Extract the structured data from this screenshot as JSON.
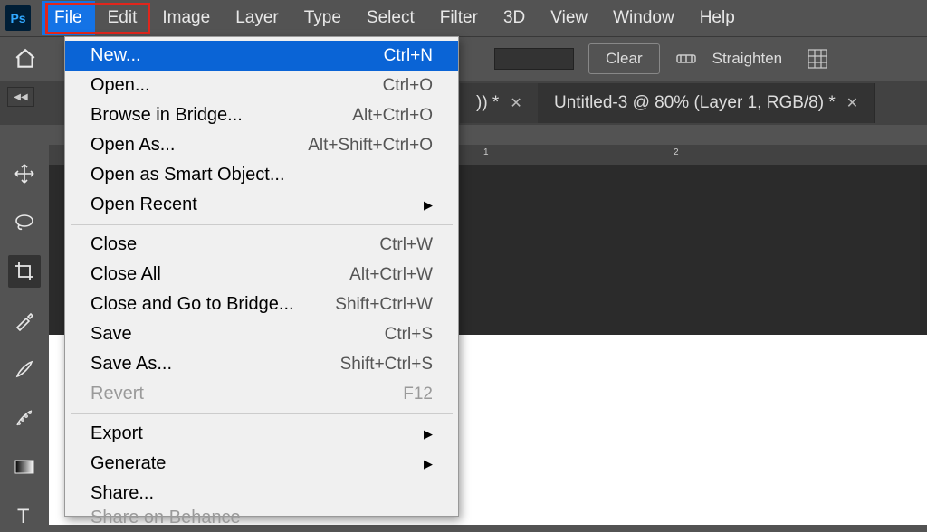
{
  "app": {
    "icon_text": "Ps"
  },
  "menubar": [
    "File",
    "Edit",
    "Image",
    "Layer",
    "Type",
    "Select",
    "Filter",
    "3D",
    "View",
    "Window",
    "Help"
  ],
  "options": {
    "clear_label": "Clear",
    "straighten_label": "Straighten"
  },
  "tabs": {
    "partial_label": ")) *",
    "third_label": "Untitled-3 @ 80% (Layer 1, RGB/8) *"
  },
  "ruler": {
    "t1": "1",
    "t2": "2"
  },
  "dropdown": [
    {
      "label": "New...",
      "shortcut": "Ctrl+N",
      "highlighted": true
    },
    {
      "label": "Open...",
      "shortcut": "Ctrl+O"
    },
    {
      "label": "Browse in Bridge...",
      "shortcut": "Alt+Ctrl+O"
    },
    {
      "label": "Open As...",
      "shortcut": "Alt+Shift+Ctrl+O"
    },
    {
      "label": "Open as Smart Object..."
    },
    {
      "label": "Open Recent",
      "submenu": true
    },
    {
      "sep": true
    },
    {
      "label": "Close",
      "shortcut": "Ctrl+W"
    },
    {
      "label": "Close All",
      "shortcut": "Alt+Ctrl+W"
    },
    {
      "label": "Close and Go to Bridge...",
      "shortcut": "Shift+Ctrl+W"
    },
    {
      "label": "Save",
      "shortcut": "Ctrl+S"
    },
    {
      "label": "Save As...",
      "shortcut": "Shift+Ctrl+S"
    },
    {
      "label": "Revert",
      "shortcut": "F12",
      "disabled": true
    },
    {
      "sep": true
    },
    {
      "label": "Export",
      "submenu": true
    },
    {
      "label": "Generate",
      "submenu": true
    },
    {
      "label": "Share..."
    },
    {
      "label": "Share on Behance",
      "disabled": true,
      "cut": true
    }
  ]
}
